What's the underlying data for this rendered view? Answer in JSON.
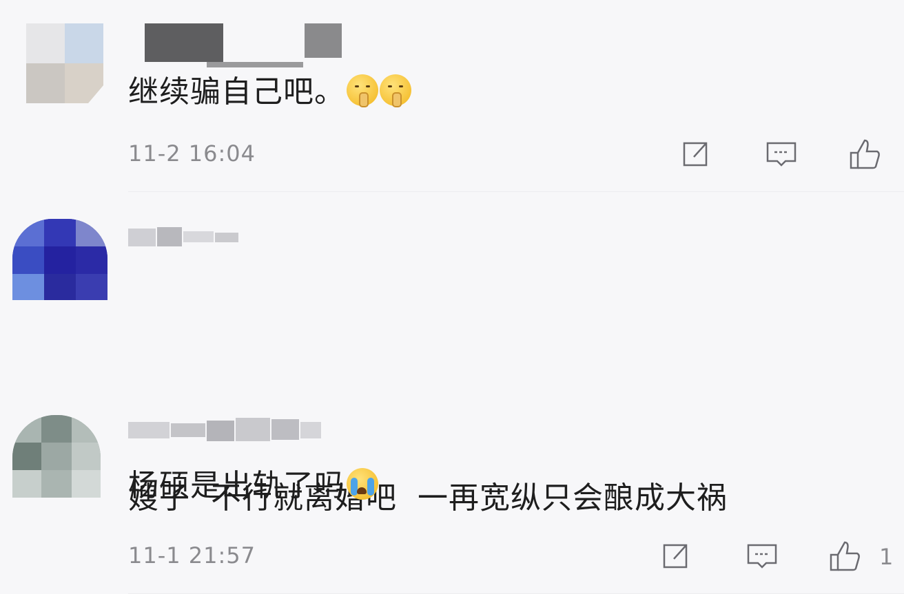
{
  "comments": [
    {
      "text": "继续骗自己吧。",
      "emojis": [
        "shush-emoji",
        "shush-emoji"
      ],
      "time": "11-2 16:04",
      "likes": ""
    },
    {
      "text": "嫂子  不行就离婚吧  一再宽纵只会酿成大祸",
      "emojis": [],
      "time": "11-1 21:57",
      "likes": "1"
    },
    {
      "text": "杨硕是出轨了吗",
      "emojis": [
        "crying-emoji"
      ],
      "time": "",
      "likes": ""
    }
  ],
  "icons": {
    "share": "share-icon",
    "reply": "reply-icon",
    "like": "like-icon"
  },
  "colors": {
    "background": "#f7f7f9",
    "text": "#1e1e1e",
    "meta": "#8a8a8e"
  }
}
